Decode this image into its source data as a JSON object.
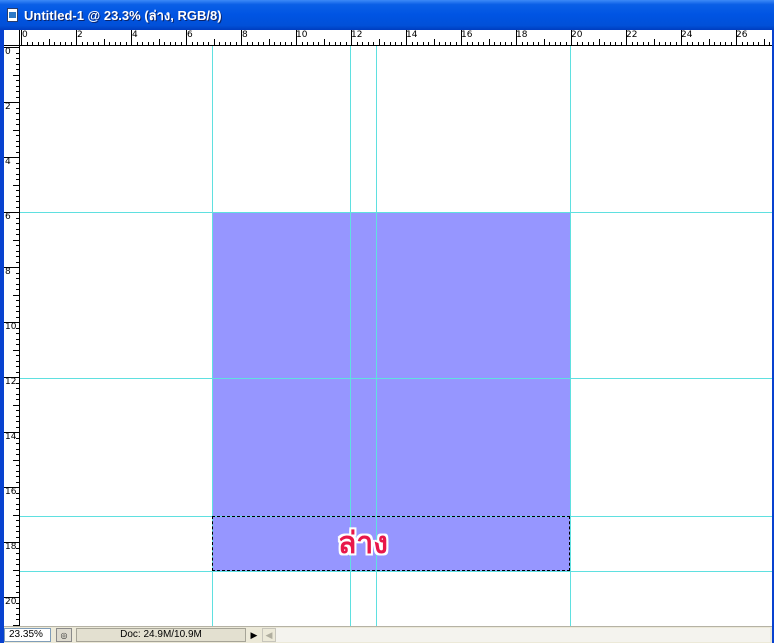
{
  "window": {
    "title": "Untitled-1 @ 23.3% (ล่าง, RGB/8)"
  },
  "icons": {
    "document": "document-icon",
    "navigator": "navigator-icon",
    "status_arrow": "triangle-right-icon",
    "scroll_left": "scroll-left-icon"
  },
  "rulers": {
    "top_labels": [
      "0",
      "2",
      "4",
      "6",
      "8",
      "10",
      "12",
      "14",
      "16",
      "18",
      "20",
      "22",
      "24",
      "26"
    ],
    "left_labels": [
      "0",
      "2",
      "4",
      "6",
      "8",
      "10",
      "12",
      "14",
      "16",
      "18",
      "20"
    ]
  },
  "canvas": {
    "background": "#ffffff",
    "shape_color": "#9696ff",
    "guide_color": "#5fe0e0",
    "text_layer": "ล่าง",
    "text_color": "#e8174a"
  },
  "status": {
    "zoom": "23.35%",
    "doc_info": "Doc: 24.9M/10.9M",
    "arrow_glyph": "▶",
    "scroll_left_glyph": "◀",
    "navigator_glyph": "◎"
  }
}
